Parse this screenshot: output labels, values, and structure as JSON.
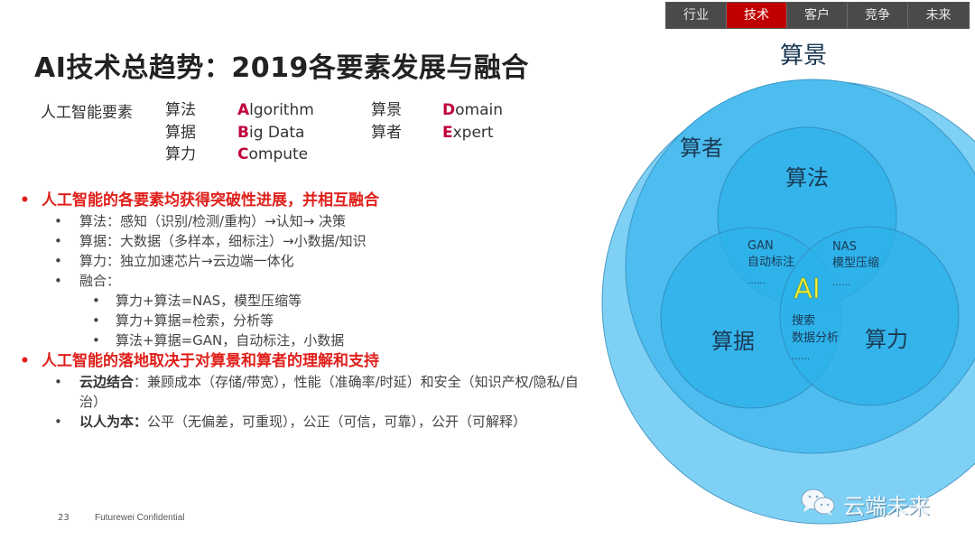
{
  "nav": {
    "items": [
      {
        "label": "行业",
        "active": false
      },
      {
        "label": "技术",
        "active": true
      },
      {
        "label": "客户",
        "active": false
      },
      {
        "label": "竞争",
        "active": false
      },
      {
        "label": "未来",
        "active": false
      }
    ],
    "active_color": "#c00000"
  },
  "title": "AI技术总趋势：2019各要素发展与融合",
  "elements": {
    "label": "人工智能要素",
    "left_cn": [
      "算法",
      "算据",
      "算力"
    ],
    "left_en": [
      {
        "initial": "A",
        "rest": "lgorithm"
      },
      {
        "initial": "B",
        "rest": "ig Data"
      },
      {
        "initial": "C",
        "rest": "ompute"
      }
    ],
    "right_cn": [
      "算景",
      "算者"
    ],
    "right_en": [
      {
        "initial": "D",
        "rest": "omain"
      },
      {
        "initial": "E",
        "rest": "xpert"
      }
    ]
  },
  "bullets": {
    "section1": {
      "heading": "人工智能的各要素均获得突破性进展，并相互融合",
      "items": [
        "算法：感知（识别/检测/重构）→认知→ 决策",
        "算据：大数据（多样本，细标注）→小数据/知识",
        "算力：独立加速芯片→云边端一体化",
        "融合："
      ],
      "sub_items": [
        "算力+算法=NAS，模型压缩等",
        "算力+算据=检索，分析等",
        "算法+算据=GAN，自动标注，小数据"
      ]
    },
    "section2": {
      "heading": "人工智能的落地取决于对算景和算者的理解和支持",
      "items": [
        {
          "bold": "云边结合",
          "text": "：兼顾成本（存储/带宽），性能（准确率/时延）和安全（知识产权/隐私/自治）"
        },
        {
          "bold": "以人为本：",
          "text": "公平（无偏差，可重现），公正（可信，可靠），公开（可解释）"
        }
      ]
    }
  },
  "diagram": {
    "outer_label": "算景",
    "middle_label": "算者",
    "venn": {
      "top": "算法",
      "left": "算据",
      "right": "算力",
      "top_left_overlap": [
        "GAN",
        "自动标注",
        "……"
      ],
      "top_right_overlap": [
        "NAS",
        "模型压缩",
        "……"
      ],
      "bottom_overlap": [
        "搜索",
        "数据分析",
        "……"
      ],
      "center": "AI"
    },
    "colors": {
      "outer": "#7fd0f5",
      "middle": "#4cbdee",
      "venn": "#2cb2ea",
      "center_text": "#f2f23a",
      "label": "#1b3a55"
    }
  },
  "footer": {
    "page_number": "23",
    "confidential": "Futurewei  Confidential"
  },
  "watermark": {
    "text": "云端未来"
  }
}
